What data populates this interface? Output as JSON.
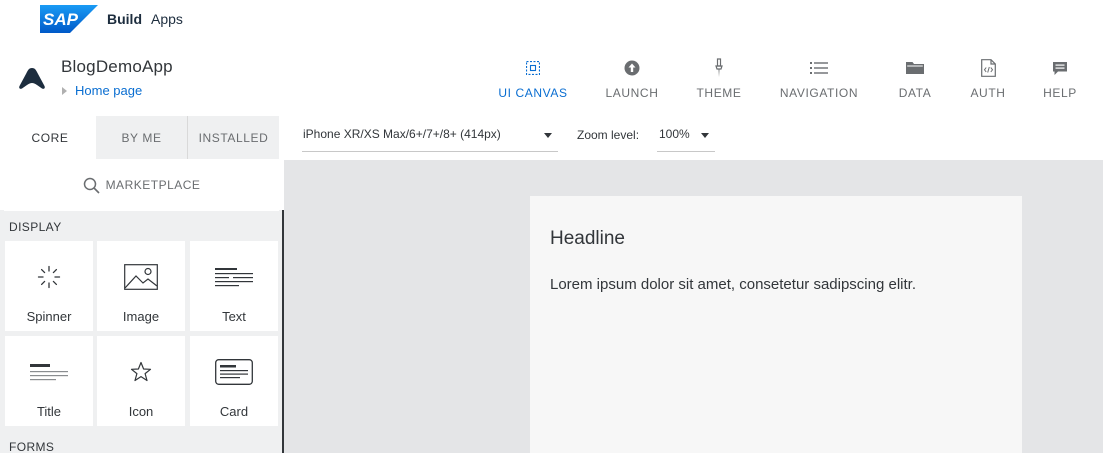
{
  "brand": {
    "logo_text": "SAP",
    "product": "Build",
    "product_suffix": "Apps"
  },
  "app": {
    "name": "BlogDemoApp",
    "page": "Home page"
  },
  "nav": [
    {
      "id": "ui-canvas",
      "label": "UI CANVAS",
      "icon": "ui-canvas-icon",
      "active": true
    },
    {
      "id": "launch",
      "label": "LAUNCH",
      "icon": "upload-icon",
      "active": false
    },
    {
      "id": "theme",
      "label": "THEME",
      "icon": "brush-icon",
      "active": false
    },
    {
      "id": "navigation",
      "label": "NAVIGATION",
      "icon": "list-icon",
      "active": false
    },
    {
      "id": "data",
      "label": "DATA",
      "icon": "folder-icon",
      "active": false
    },
    {
      "id": "auth",
      "label": "AUTH",
      "icon": "code-file-icon",
      "active": false
    },
    {
      "id": "help",
      "label": "HELP",
      "icon": "chat-icon",
      "active": false
    }
  ],
  "panel": {
    "tabs": [
      {
        "label": "CORE",
        "active": true
      },
      {
        "label": "BY ME",
        "active": false
      },
      {
        "label": "INSTALLED",
        "active": false
      }
    ],
    "marketplace": "MARKETPLACE",
    "sections": {
      "display": "DISPLAY",
      "forms": "FORMS"
    },
    "tiles": [
      {
        "label": "Spinner",
        "icon": "spinner-icon"
      },
      {
        "label": "Image",
        "icon": "image-icon"
      },
      {
        "label": "Text",
        "icon": "text-icon"
      },
      {
        "label": "Title",
        "icon": "title-icon"
      },
      {
        "label": "Icon",
        "icon": "star-icon"
      },
      {
        "label": "Card",
        "icon": "card-icon"
      }
    ]
  },
  "toolbar": {
    "device": "iPhone XR/XS Max/6+/7+/8+ (414px)",
    "zoom_label": "Zoom level:",
    "zoom_value": "100%"
  },
  "canvas": {
    "headline": "Headline",
    "paragraph": "Lorem ipsum dolor sit amet, consetetur sadipscing elitr."
  },
  "colors": {
    "accent": "#0a6ed1",
    "sap_blue": "#0070f2",
    "text": "#32363a",
    "canvas_bg": "#e4e5e7",
    "panel_bg": "#eff0f1"
  }
}
